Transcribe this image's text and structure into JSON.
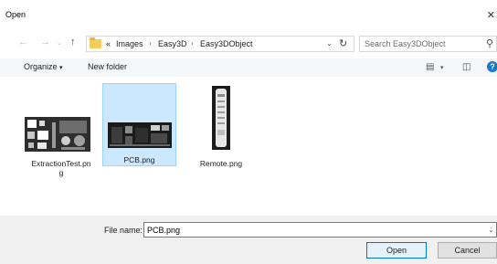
{
  "window": {
    "title": "Open"
  },
  "nav": {
    "path": [
      "«",
      "Images",
      "Easy3D",
      "Easy3DObject"
    ],
    "search_placeholder": "Search Easy3DObject"
  },
  "toolbar": {
    "organize": "Organize",
    "new_folder": "New folder"
  },
  "files": [
    {
      "name_line1": "ExtractionTest.pn",
      "name_line2": "g",
      "selected": false
    },
    {
      "name_line1": "PCB.png",
      "name_line2": "",
      "selected": true
    },
    {
      "name_line1": "Remote.png",
      "name_line2": "",
      "selected": false
    }
  ],
  "bottom": {
    "file_name_label": "File name:",
    "file_name_value": "PCB.png",
    "open_label": "Open",
    "cancel_label": "Cancel"
  },
  "colors": {
    "selection": "#cce8ff",
    "accent": "#0078d7",
    "folder": "#f6cd5a"
  }
}
